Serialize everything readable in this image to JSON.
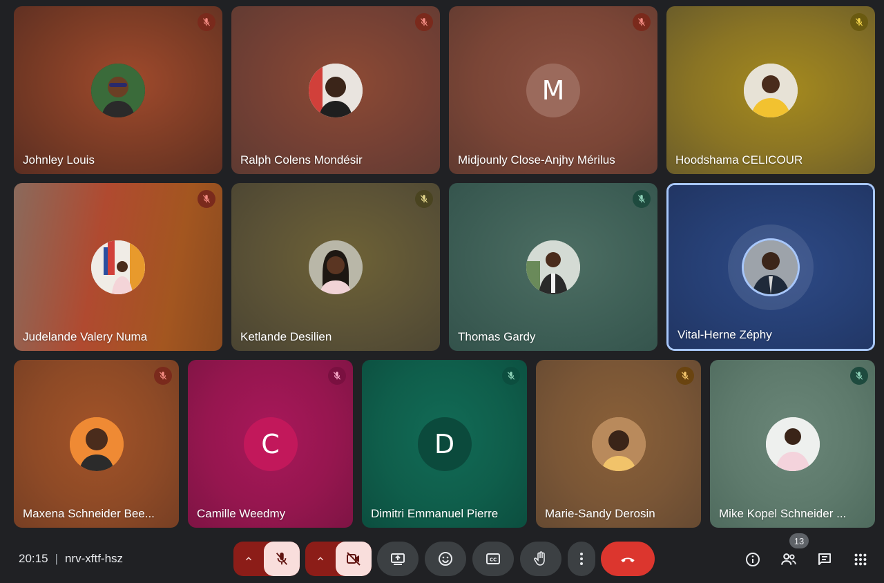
{
  "participants": [
    {
      "name": "Johnley Louis"
    },
    {
      "name": "Ralph Colens Mondésir"
    },
    {
      "name": "Midjounly Close-Anjhy Mérilus",
      "initial": "M"
    },
    {
      "name": "Hoodshama CELICOUR"
    },
    {
      "name": "Judelande Valery Numa"
    },
    {
      "name": "Ketlande Desilien"
    },
    {
      "name": "Thomas Gardy"
    },
    {
      "name": "Vital-Herne Zéphy"
    },
    {
      "name": "Maxena Schneider Bee..."
    },
    {
      "name": "Camille Weedmy",
      "initial": "C"
    },
    {
      "name": "Dimitri Emmanuel Pierre",
      "initial": "D"
    },
    {
      "name": "Marie-Sandy Derosin"
    },
    {
      "name": "Mike Kopel Schneider ..."
    }
  ],
  "meeting": {
    "time": "20:15",
    "separator": "|",
    "code": "nrv-xftf-hsz"
  },
  "controls": {
    "participant_count": "13"
  },
  "icons": {
    "mic": "mic-off-icon",
    "camera": "videocam-off-icon",
    "present": "present-screen-icon",
    "emoji": "emoji-icon",
    "captions": "closed-captions-icon",
    "hand": "raise-hand-icon",
    "more": "more-vertical-icon",
    "end": "call-end-icon",
    "info": "info-icon",
    "people": "people-icon",
    "chat": "chat-icon",
    "activities": "apps-grid-icon"
  },
  "colors": {
    "end_call": "#dc362e",
    "muted_control": "#8c1d18",
    "speaking_border": "#a8c7fa"
  }
}
